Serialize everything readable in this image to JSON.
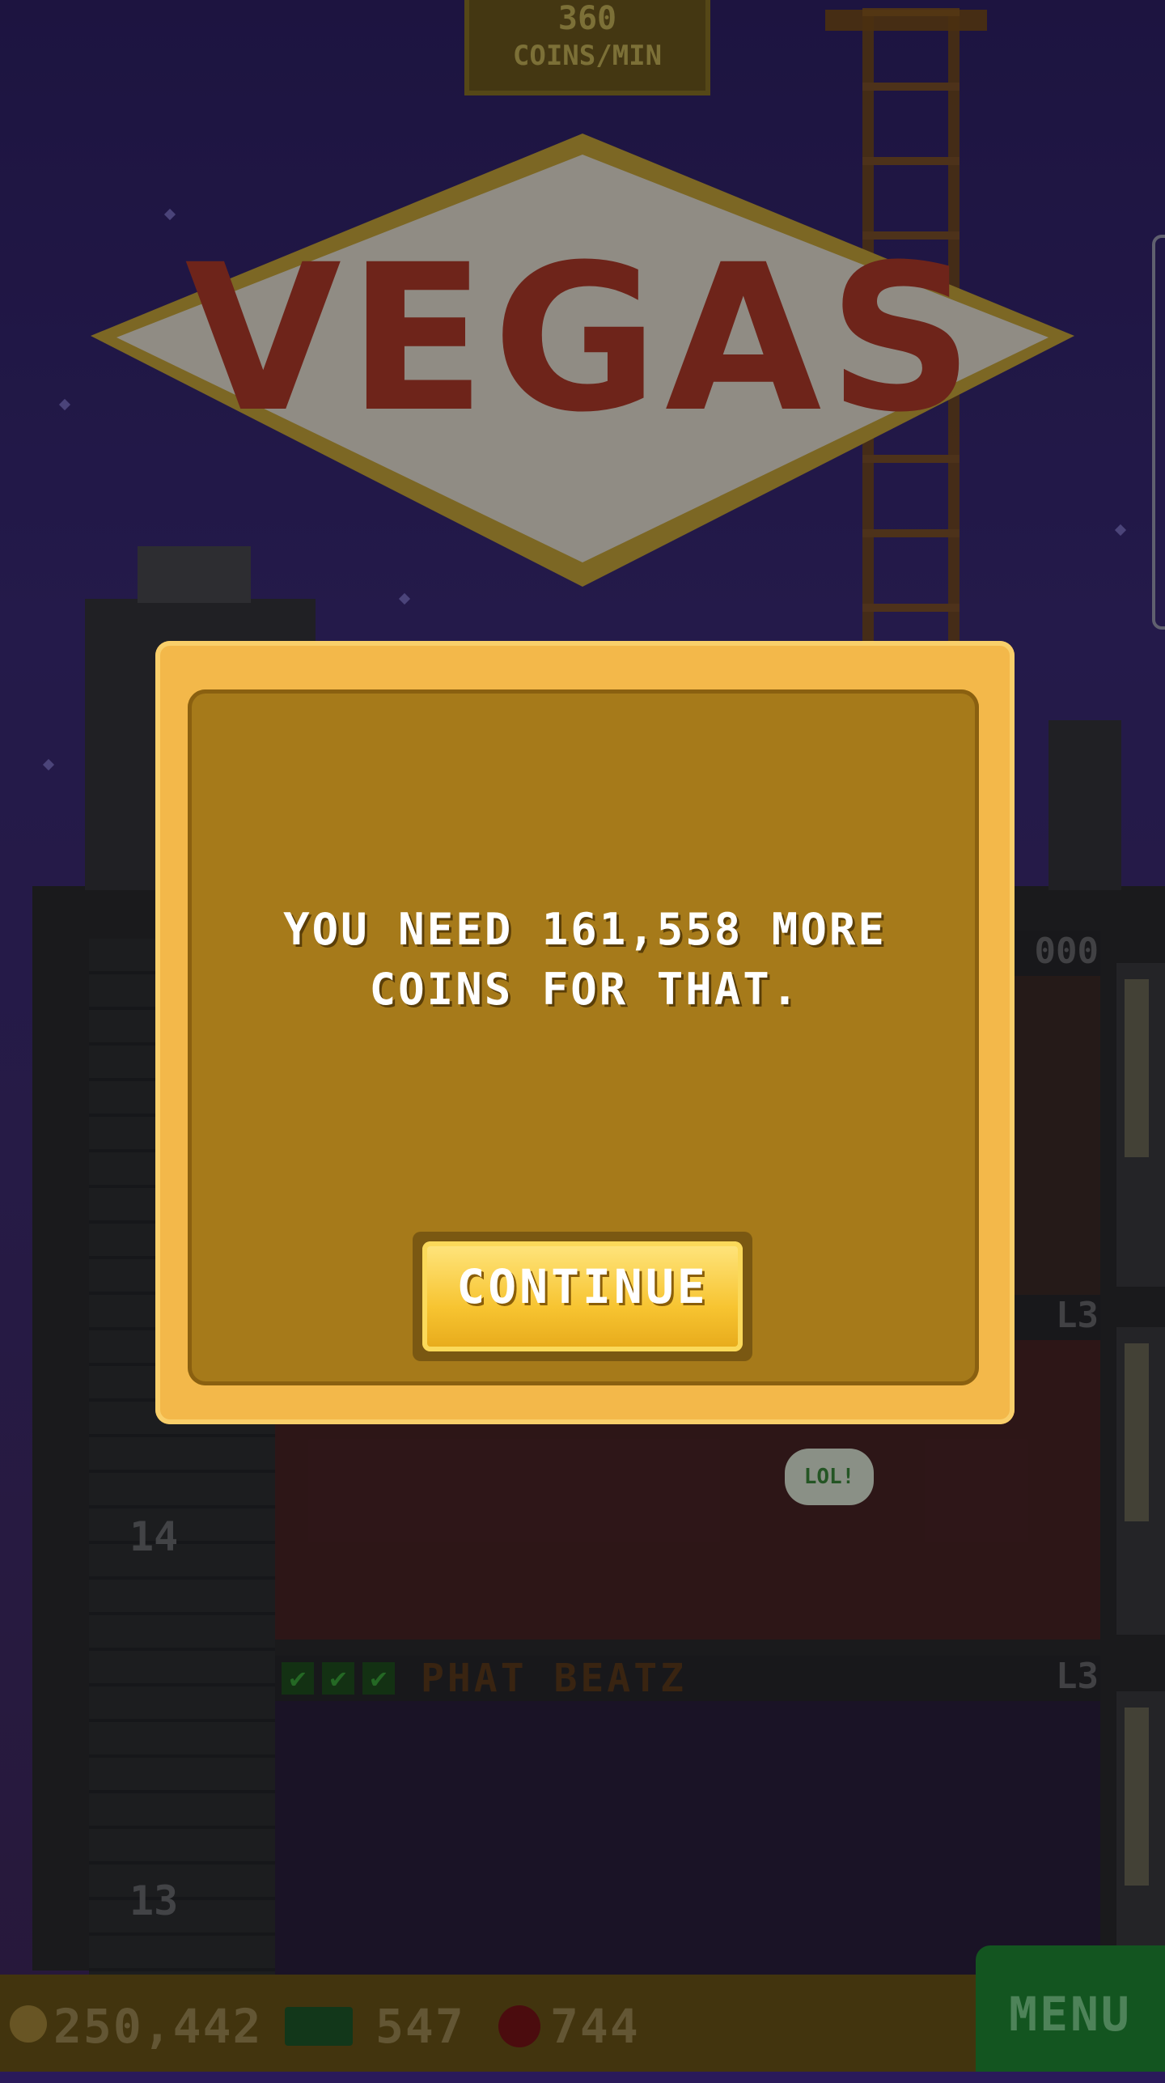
{
  "top_rate": {
    "value": "360",
    "unit": "COINS/MIN"
  },
  "sign": {
    "text": "VEGAS"
  },
  "floors": [
    {
      "title": "",
      "level": "L3"
    },
    {
      "number": "14"
    },
    {
      "title": "PHAT BEATZ",
      "level": "L3"
    },
    {
      "number": "13"
    }
  ],
  "partial_label": "000",
  "dialog": {
    "message_line1": "YOU NEED 161,558 MORE",
    "message_line2": "COINS FOR THAT.",
    "button_label": "CONTINUE"
  },
  "status": {
    "coins": "250,442",
    "bux": "547",
    "gems": "744"
  },
  "menu": {
    "label": "MENU"
  },
  "speech": "LOL!",
  "colors": {
    "dialog_outer": "#f3b84a",
    "dialog_inner": "#a67a1a",
    "button": "#f7c431",
    "menu": "#1f8a35"
  }
}
